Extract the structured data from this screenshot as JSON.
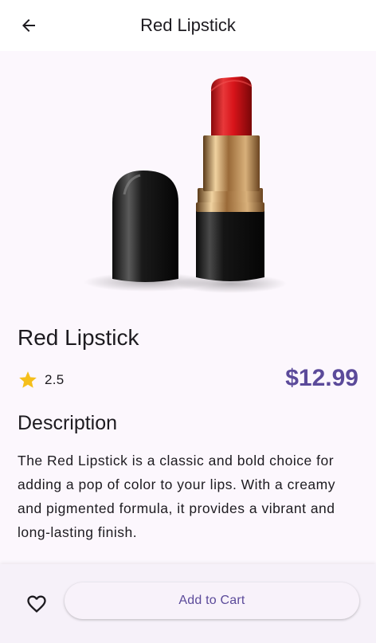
{
  "appbar": {
    "title": "Red Lipstick",
    "back_icon": "arrow-back-icon"
  },
  "product": {
    "name": "Red Lipstick",
    "rating": "2.5",
    "rating_icon": "star-icon",
    "price": "$12.99"
  },
  "description": {
    "title": "Description",
    "body": "The Red Lipstick is a classic and bold choice for adding a pop of color to your lips. With a creamy and pigmented formula, it provides a vibrant and long-lasting finish."
  },
  "actions": {
    "favorite_icon": "heart-outline-icon",
    "add_to_cart_label": "Add to Cart"
  },
  "colors": {
    "accent": "#5b4a9a",
    "star": "#f5bf1b",
    "background": "#fcf7fd",
    "lipstick_red": "#d8141a"
  }
}
